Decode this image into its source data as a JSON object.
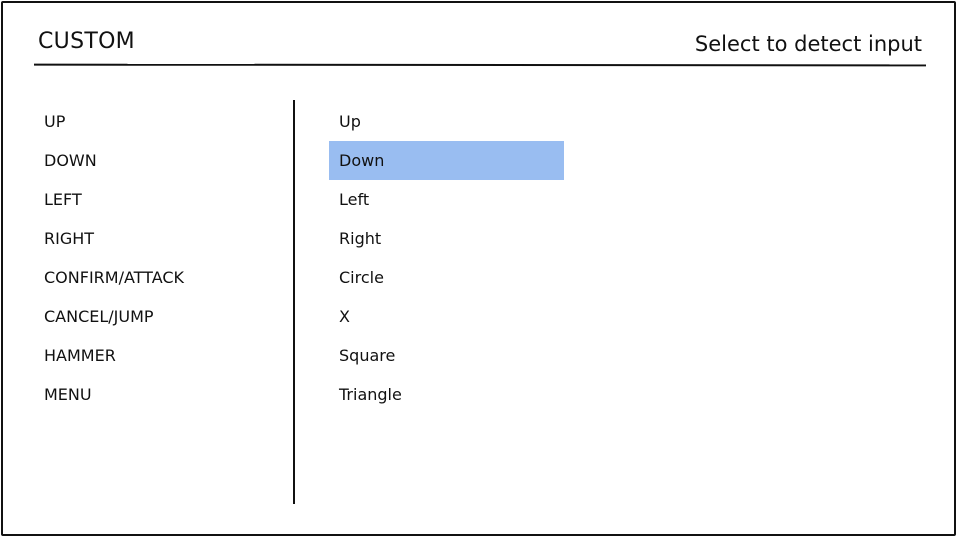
{
  "screen": {
    "title": "CUSTOM",
    "hint": "Select to detect input"
  },
  "controls": [
    {
      "action": "UP",
      "binding": "Up"
    },
    {
      "action": "DOWN",
      "binding": "Down"
    },
    {
      "action": "LEFT",
      "binding": "Left"
    },
    {
      "action": "RIGHT",
      "binding": "Right"
    },
    {
      "action": "CONFIRM/ATTACK",
      "binding": "Circle"
    },
    {
      "action": "CANCEL/JUMP",
      "binding": "X"
    },
    {
      "action": "HAMMER",
      "binding": "Square"
    },
    {
      "action": "MENU",
      "binding": "Triangle"
    }
  ],
  "selected_index": 1,
  "colors": {
    "selection": "#99bdf1",
    "ink": "#111111",
    "background": "#ffffff"
  }
}
